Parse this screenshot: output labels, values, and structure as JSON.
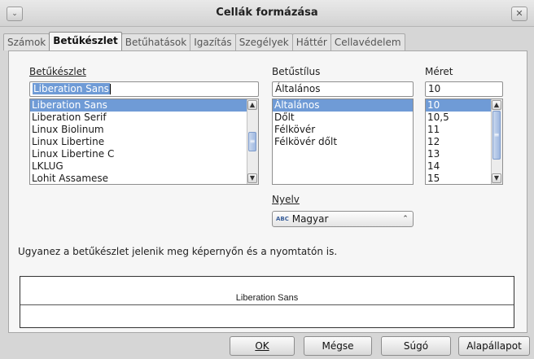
{
  "window": {
    "title": "Cellák formázása",
    "menu_glyph": "⌄",
    "close_glyph": "✕"
  },
  "tabs": [
    {
      "label": "Számok"
    },
    {
      "label": "Betűkészlet",
      "active": true
    },
    {
      "label": "Betűhatások"
    },
    {
      "label": "Igazítás"
    },
    {
      "label": "Szegélyek"
    },
    {
      "label": "Háttér"
    },
    {
      "label": "Cellavédelem"
    }
  ],
  "font": {
    "family_label": "Betűkészlet",
    "family_value": "Liberation Sans",
    "family_list": [
      "Liberation Sans",
      "Liberation Serif",
      "Linux Biolinum",
      "Linux Libertine",
      "Linux Libertine C",
      "LKLUG",
      "Lohit Assamese"
    ],
    "style_label": "Betűstílus",
    "style_value": "Általános",
    "style_list": [
      "Általános",
      "Dőlt",
      "Félkövér",
      "Félkövér dőlt"
    ],
    "size_label": "Méret",
    "size_value": "10",
    "size_list": [
      "10",
      "10,5",
      "11",
      "12",
      "13",
      "14",
      "15"
    ],
    "language_label": "Nyelv",
    "language_value": "Magyar",
    "language_icon": "ABC"
  },
  "info_text": "Ugyanez a betűkészlet jelenik meg képernyőn és a nyomtatón is.",
  "preview": {
    "text": "Liberation Sans"
  },
  "buttons": {
    "ok": "OK",
    "cancel": "Mégse",
    "help": "Súgó",
    "reset": "Alapállapot"
  },
  "scroll_glyphs": {
    "up": "▲",
    "down": "▼",
    "thumb": "≡"
  }
}
